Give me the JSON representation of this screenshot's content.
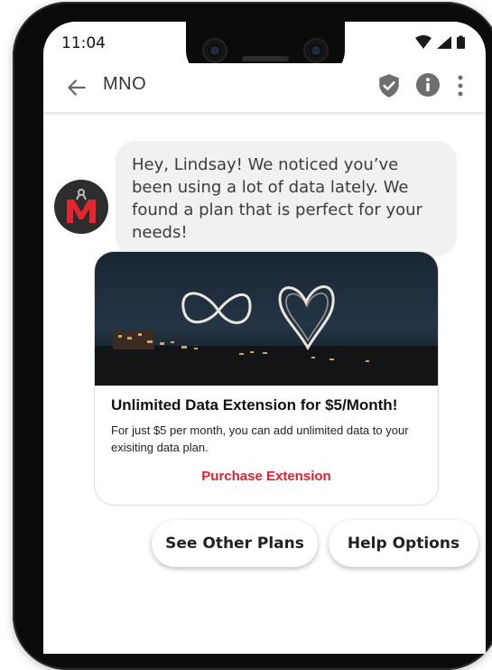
{
  "status_bar": {
    "time": "11:04"
  },
  "header": {
    "title": "MNO"
  },
  "icons": {
    "back": "back-arrow-icon",
    "verified": "verified-shield-icon",
    "info": "info-icon",
    "more": "more-vert-icon",
    "avatar": "brand-logo-avatar"
  },
  "message": {
    "text": "Hey, Lindsay! We noticed you’ve been using a lot of data lately. We found a plan that is perfect for your needs!"
  },
  "card": {
    "title": "Unlimited Data Extension for $5/Month!",
    "description": "For just $5 per month, you can add unlimited data to your exisiting data plan.",
    "action_label": "Purchase Extension"
  },
  "suggestions": [
    {
      "label": "See Other Plans"
    },
    {
      "label": "Help Options"
    }
  ],
  "colors": {
    "accent": "#e0202e",
    "bubble": "#eff1f3",
    "logo_red": "#e3262e"
  }
}
